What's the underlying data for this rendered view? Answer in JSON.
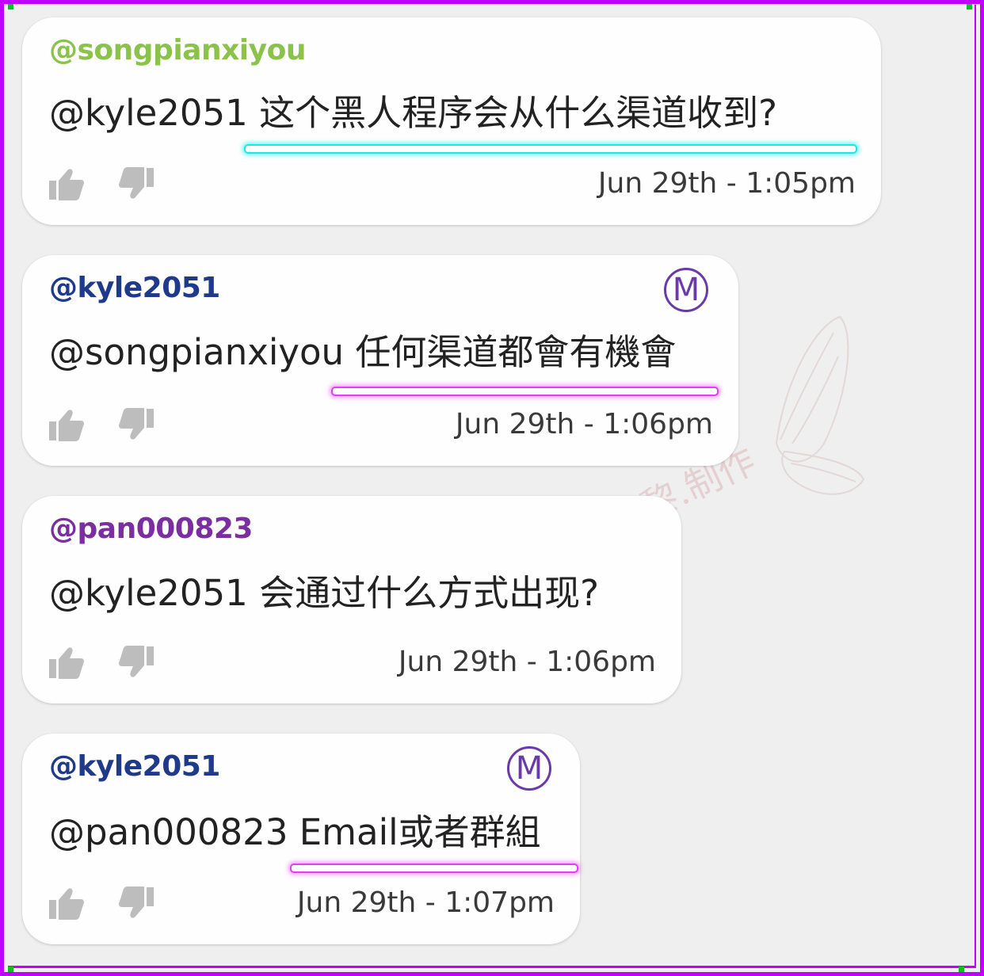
{
  "colors": {
    "frame": "#c100ff",
    "user_green": "#8bc34a",
    "user_navy": "#1f3a8a",
    "user_purple": "#7a2ea0",
    "mod_badge": "#6a3aa8",
    "underline_cyan": "#1fe6e6",
    "underline_magenta": "#e040f0"
  },
  "watermark": {
    "text": "黎黎.制作"
  },
  "comments": [
    {
      "username": "@songpianxiyou",
      "message": "@kyle2051 这个黑人程序会从什么渠道收到?",
      "timestamp": "Jun 29th - 1:05pm",
      "is_moderator": false,
      "badge": "",
      "username_color": "green",
      "underline_color": "cyan",
      "like_icon": "thumbs-up-icon",
      "dislike_icon": "thumbs-down-icon"
    },
    {
      "username": "@kyle2051",
      "message": "@songpianxiyou 任何渠道都會有機會",
      "timestamp": "Jun 29th - 1:06pm",
      "is_moderator": true,
      "badge": "M",
      "username_color": "navy",
      "underline_color": "magenta",
      "like_icon": "thumbs-up-icon",
      "dislike_icon": "thumbs-down-icon"
    },
    {
      "username": "@pan000823",
      "message": "@kyle2051 会通过什么方式出现?",
      "timestamp": "Jun 29th - 1:06pm",
      "is_moderator": false,
      "badge": "",
      "username_color": "purple",
      "underline_color": "none",
      "like_icon": "thumbs-up-icon",
      "dislike_icon": "thumbs-down-icon"
    },
    {
      "username": "@kyle2051",
      "message": "@pan000823 Email或者群組",
      "timestamp": "Jun 29th - 1:07pm",
      "is_moderator": true,
      "badge": "M",
      "username_color": "navy",
      "underline_color": "magenta",
      "like_icon": "thumbs-up-icon",
      "dislike_icon": "thumbs-down-icon"
    }
  ]
}
